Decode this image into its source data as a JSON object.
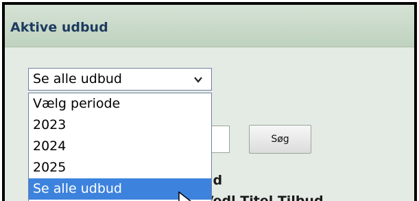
{
  "header": {
    "title": "Aktive udbud"
  },
  "select": {
    "value": "Se alle udbud",
    "options": [
      "Vælg periode",
      "2023",
      "2024",
      "2025",
      "Se alle udbud"
    ],
    "highlighted_option": "Se alle udbud"
  },
  "search": {
    "button_label": "Søg"
  },
  "background_text": {
    "partial_heading": "ud",
    "partial_line": "Vedl Titel  Tilbud"
  },
  "colors": {
    "header_text": "#1d3b5e",
    "selected_option_bg": "#3d83de",
    "panel_bg": "#e4ebe4"
  }
}
